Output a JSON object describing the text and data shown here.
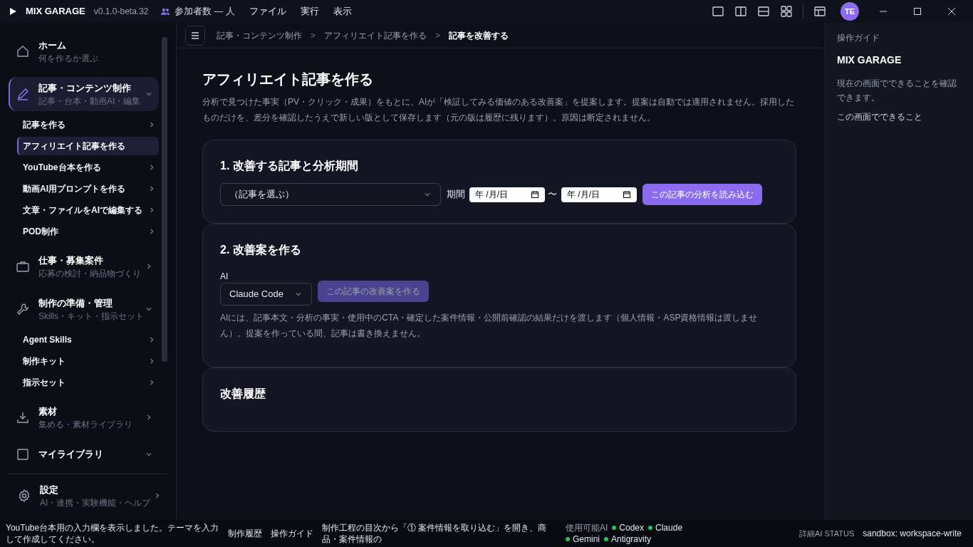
{
  "titlebar": {
    "app_name": "MIX GARAGE",
    "version": "v0.1.0-beta.32",
    "participants": "参加者数 — 人",
    "menus": [
      "ファイル",
      "実行",
      "表示"
    ],
    "avatar": "TE"
  },
  "sidebar": {
    "sections": [
      {
        "title": "ホーム",
        "subtitle": "何を作るか選ぶ",
        "selected": false
      },
      {
        "title": "記事・コンテンツ制作",
        "subtitle": "記事・台本・動画AI・編集",
        "selected": true,
        "expanded": true,
        "children": [
          {
            "label": "記事を作る",
            "selected": false
          },
          {
            "label": "アフィリエイト記事を作る",
            "selected": true
          },
          {
            "label": "YouTube台本を作る",
            "selected": false
          },
          {
            "label": "動画AI用プロンプトを作る",
            "selected": false
          },
          {
            "label": "文章・ファイルをAIで編集する",
            "selected": false
          },
          {
            "label": "POD制作",
            "selected": false
          }
        ]
      },
      {
        "title": "仕事・募集案件",
        "subtitle": "応募の検討・納品物づくり",
        "selected": false,
        "expanded": false
      },
      {
        "title": "制作の準備・管理",
        "subtitle": "Skills・キット・指示セット",
        "selected": false,
        "expanded": true,
        "children": [
          {
            "label": "Agent Skills",
            "selected": false
          },
          {
            "label": "制作キット",
            "selected": false
          },
          {
            "label": "指示セット",
            "selected": false
          }
        ]
      },
      {
        "title": "素材",
        "subtitle": "集める・素材ライブラリ",
        "selected": false,
        "expanded": false
      },
      {
        "title": "マイライブラリ",
        "selected": false,
        "expanded": true
      }
    ],
    "settings": {
      "title": "設定",
      "subtitle": "AI・連携・実験機能・ヘルプ"
    }
  },
  "breadcrumb": {
    "separator": ">",
    "items": [
      "記事・コンテンツ制作",
      "アフィリエイト記事を作る",
      "記事を改善する"
    ]
  },
  "page": {
    "title": "アフィリエイト記事を作る",
    "description": "分析で見つけた事実（PV・クリック・成果）をもとに、AIが「検証してみる価値のある改善案」を提案します。提案は自動では適用されません。採用したものだけを、差分を確認したうえで新しい版として保存します（元の版は履歴に残ります）。原因は断定されません。"
  },
  "step1": {
    "title": "1. 改善する記事と分析期間",
    "article_select": "（記事を選ぶ）",
    "period_label": "期間",
    "date_from": "年 /月/日",
    "separator": "〜",
    "date_to": "年 /月/日",
    "button": "この記事の分析を読み込む"
  },
  "step2": {
    "title": "2. 改善案を作る",
    "ai_label": "AI",
    "ai_select": "Claude Code",
    "button": "この記事の改善案を作る",
    "button_disabled": true,
    "note": "AIには、記事本文・分析の事実・使用中のCTA・確定した案件情報・公開前確認の結果だけを渡します（個人情報・ASP資格情報は渡しません）。提案を作っている間、記事は書き換えません。"
  },
  "history": {
    "title": "改善履歴"
  },
  "guide": {
    "label": "操作ガイド",
    "title": "MIX GARAGE",
    "text": "現在の画面でできることを確認できます。",
    "link": "この画面でできること"
  },
  "status_bar": {
    "message": "YouTube台本用の入力欄を表示しました。テーマを入力して作成してください。",
    "links": [
      "制作履歴",
      "操作ガイド"
    ],
    "hint": "制作工程の目次から「① 案件情報を取り込む」を開き、商品・案件情報の",
    "ai_label": "使用可能AI",
    "ais": [
      {
        "name": "Codex",
        "color": "#22c55e"
      },
      {
        "name": "Claude",
        "color": "#22c55e"
      },
      {
        "name": "Gemini",
        "color": "#22c55e"
      },
      {
        "name": "Antigravity",
        "color": "#22c55e"
      }
    ],
    "detail": "詳細AI STATUS",
    "sandbox": "sandbox: workspace-write"
  }
}
